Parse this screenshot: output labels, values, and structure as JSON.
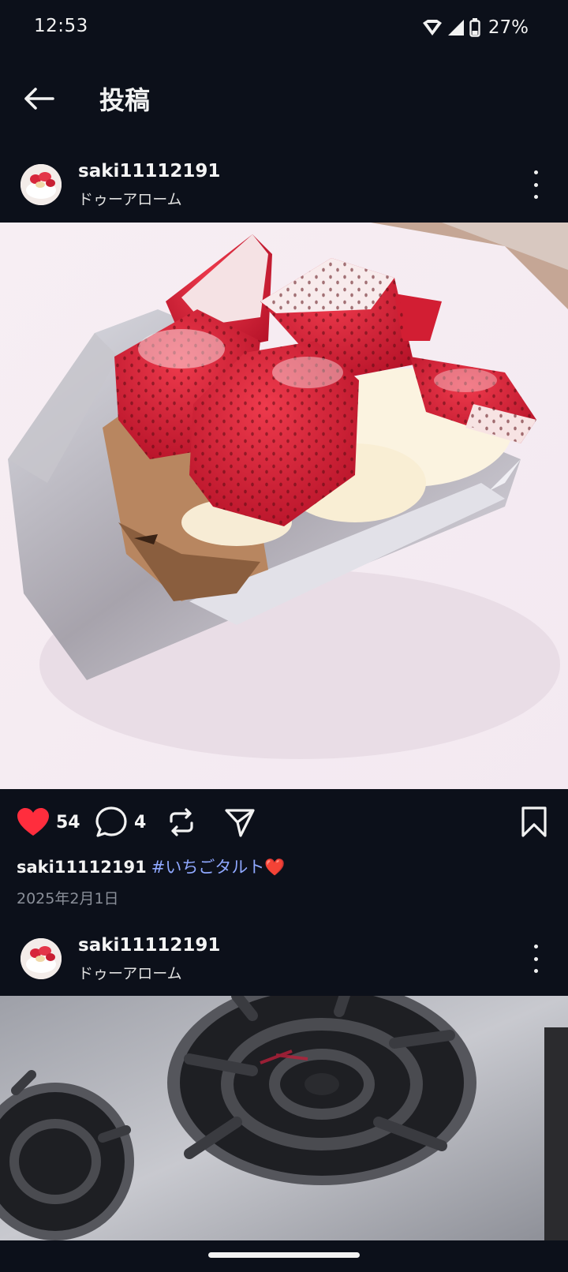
{
  "status_bar": {
    "time": "12:53",
    "battery": "27%"
  },
  "header": {
    "title": "投稿"
  },
  "posts": [
    {
      "username": "saki11112191",
      "location": "ドゥーアローム",
      "likes": "54",
      "comments": "4",
      "caption_user": "saki11112191",
      "caption_hashtag": "#いちごタルト",
      "caption_emoji": "❤️",
      "date": "2025年2月1日"
    },
    {
      "username": "saki11112191",
      "location": "ドゥーアローム"
    }
  ],
  "colors": {
    "background": "#0c101a",
    "like": "#ff2d3d",
    "hashtag": "#8fa8ff"
  }
}
